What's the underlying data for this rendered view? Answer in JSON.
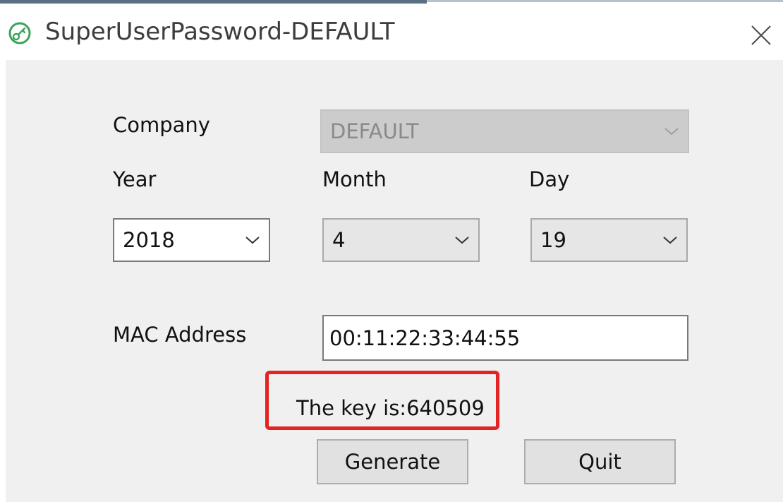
{
  "window": {
    "title": "SuperUserPassword-DEFAULT",
    "icon": "key-icon",
    "close_icon": "close-icon"
  },
  "form": {
    "company_label": "Company",
    "company_value": "DEFAULT",
    "year_label": "Year",
    "month_label": "Month",
    "day_label": "Day",
    "year_value": "2018",
    "month_value": "4",
    "day_value": "19",
    "mac_label": "MAC Address",
    "mac_value": "00:11:22:33:44:55",
    "key_text": "The key is:640509"
  },
  "buttons": {
    "generate_label": "Generate",
    "quit_label": "Quit"
  },
  "colors": {
    "highlight": "#e42323",
    "icon_green": "#3aa35a",
    "accent": "#5a6e84"
  }
}
